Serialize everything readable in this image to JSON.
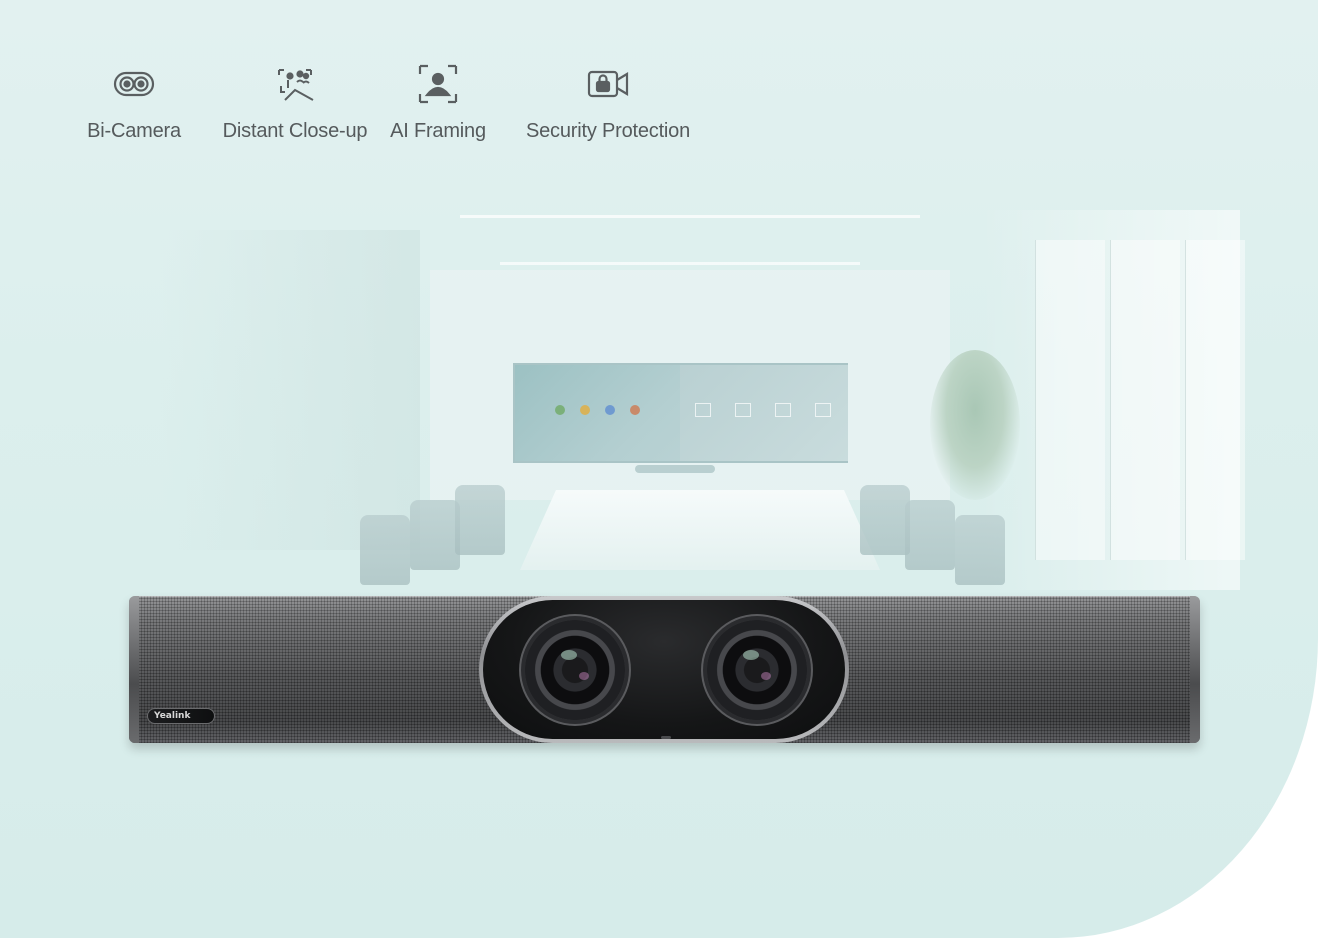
{
  "features": [
    {
      "icon": "dual-camera-icon",
      "label": "Bi-Camera"
    },
    {
      "icon": "distant-closeup-icon",
      "label": "Distant Close-up"
    },
    {
      "icon": "ai-framing-icon",
      "label": "AI Framing"
    },
    {
      "icon": "camera-lock-icon",
      "label": "Security Protection"
    }
  ],
  "device": {
    "brand": "Yealink"
  },
  "colors": {
    "background_tint": "#dcefed",
    "label_text": "#555a5c",
    "icon_stroke": "#5a5f61"
  }
}
